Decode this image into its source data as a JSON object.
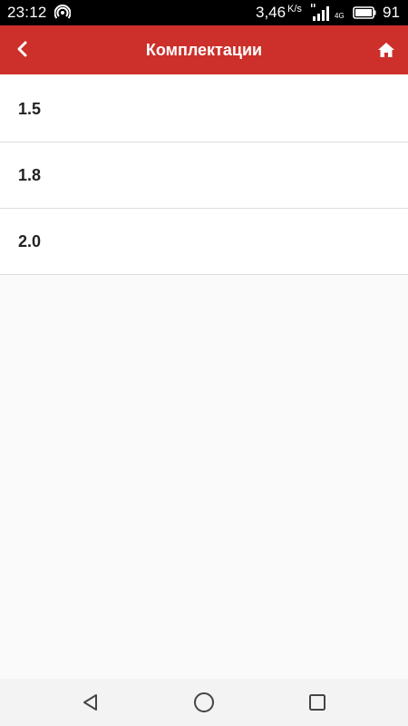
{
  "status_bar": {
    "time": "23:12",
    "speed": "3,46",
    "speed_unit": "K/s",
    "network": "4G",
    "battery": "91"
  },
  "app_bar": {
    "title": "Комплектации",
    "background_color": "#cd2f2a"
  },
  "list": {
    "items": [
      {
        "label": "1.5"
      },
      {
        "label": "1.8"
      },
      {
        "label": "2.0"
      }
    ]
  },
  "nav_bar": {
    "back_icon": "triangle-back-icon",
    "home_icon": "circle-home-icon",
    "recents_icon": "square-recents-icon"
  }
}
